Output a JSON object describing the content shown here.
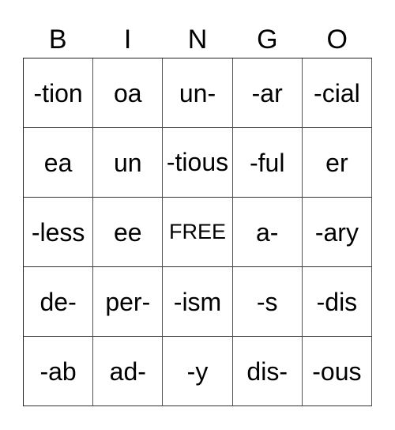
{
  "header": [
    "B",
    "I",
    "N",
    "G",
    "O"
  ],
  "rows": [
    [
      "-tion",
      "oa",
      "un-",
      "-ar",
      "-cial"
    ],
    [
      "ea",
      "un",
      "-tious",
      "-ful",
      "er"
    ],
    [
      "-less",
      "ee",
      "FREE",
      "a-",
      "-ary"
    ],
    [
      "de-",
      "per-",
      "-ism",
      "-s",
      "-dis"
    ],
    [
      "-ab",
      "ad-",
      "-y",
      "dis-",
      "-ous"
    ]
  ],
  "free_label": "FREE"
}
